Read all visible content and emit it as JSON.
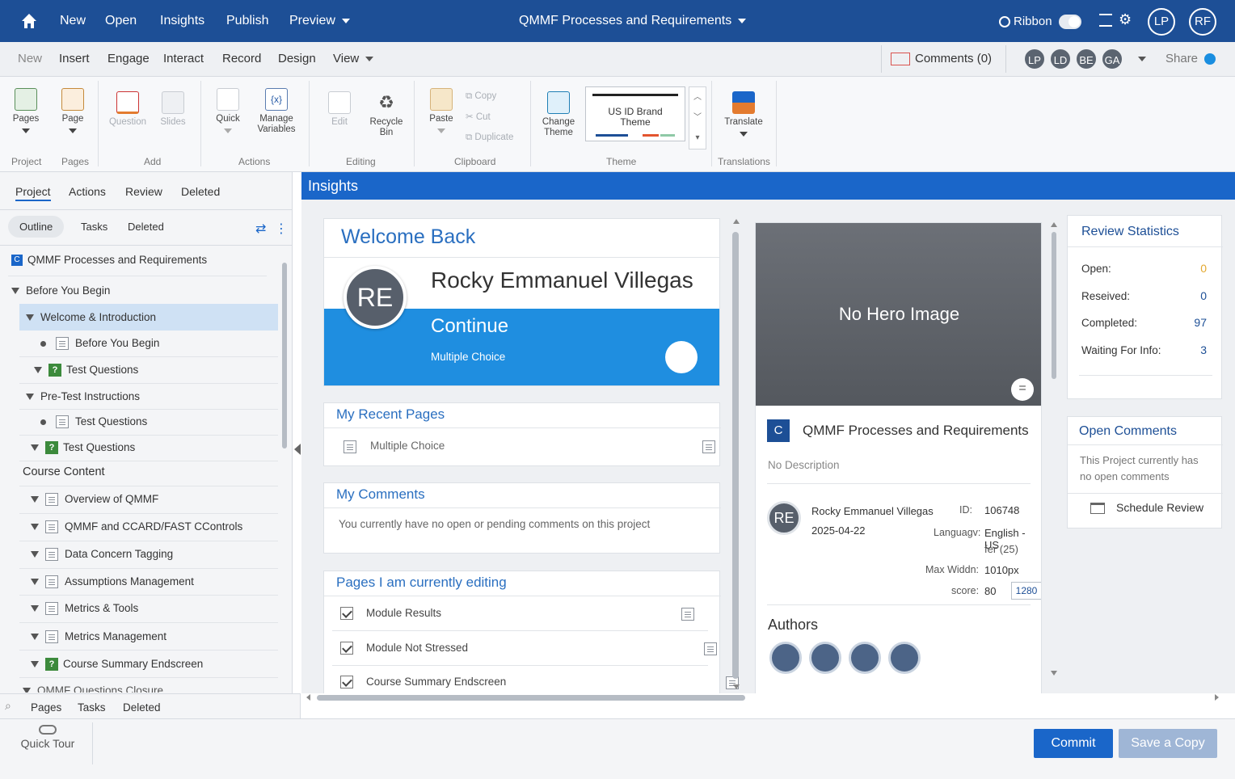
{
  "topbar": {
    "nav": [
      "New",
      "Open",
      "Insights",
      "Publish",
      "Preview"
    ],
    "project_title": "QMMF Processes and Requirements",
    "ribbon_label": "Ribbon",
    "user1": "LP",
    "user2": "RF"
  },
  "menubar": {
    "items": [
      "New",
      "Insert",
      "Engage",
      "Interact",
      "Record",
      "Design",
      "View"
    ],
    "comments_label": "Comments",
    "comments_count": "(0)",
    "avatars": [
      "LP",
      "LD",
      "BE",
      "GA"
    ],
    "share_label": "Share"
  },
  "ribbon": {
    "pages": "Pages",
    "page": "Page",
    "question": "Question",
    "slides": "Slides",
    "quick": "Quick",
    "manage_variables_1": "Manage",
    "manage_variables_2": "Variables",
    "edit": "Edit",
    "recycle_1": "Recycle",
    "recycle_2": "Bin",
    "paste": "Paste",
    "copy": "Copy",
    "cut": "Cut",
    "duplicate": "Duplicate",
    "change_theme_1": "Change",
    "change_theme_2": "Theme",
    "theme_preview_1": "US ID Brand",
    "theme_preview_2": "Theme",
    "translate": "Translate",
    "groups": {
      "project": "Project",
      "pages": "Pages",
      "add": "Add",
      "actions": "Actions",
      "editing": "Editing",
      "clipboard": "Clipboard",
      "theme": "Theme",
      "translations": "Translations"
    }
  },
  "left": {
    "tabs": [
      "Project",
      "Actions",
      "Review",
      "Deleted"
    ],
    "subtabs": [
      "Outline",
      "Tasks",
      "Deleted"
    ],
    "root": "QMMF Processes and Requirements",
    "root_badge": "C",
    "tree": {
      "before_you_begin": "Before You Begin",
      "welcome": "Welcome & Introduction",
      "before_you_begin_page": "Before You Begin",
      "test_questions_1": "Test Questions",
      "pretest": "Pre-Test Instructions",
      "test_questions_2": "Test Questions",
      "test_questions_3": "Test Questions",
      "course_content": "Course Content",
      "overview": "Overview of QMMF",
      "ccard": "QMMF and CCARD/FAST CControls",
      "data_concern": "Data Concern Tagging",
      "assumptions": "Assumptions Management",
      "metrics_tools": "Metrics & Tools",
      "metrics_mgmt": "Metrics Management",
      "course_summary": "Course Summary Endscreen",
      "cut_off": "QMMF Questions Closure"
    },
    "bottom_tabs": [
      "Pages",
      "Tasks",
      "Deleted"
    ],
    "quick_tour": "Quick Tour"
  },
  "insights": {
    "header": "Insights",
    "welcome_title": "Welcome Back",
    "avatar_initials": "RE",
    "user_name": "Rocky Emmanuel Villegas",
    "continue_label": "Continue",
    "continue_sub": "Multiple Choice",
    "recent_title": "My Recent Pages",
    "recent_item": "Multiple Choice",
    "comments_title": "My Comments",
    "comments_text": "You currently have no open or pending comments on this project",
    "editing_title": "Pages I am currently editing",
    "editing_items": [
      "Module Results",
      "Module Not Stressed",
      "Course Summary Endscreen"
    ],
    "hero_text": "No Hero Image",
    "project_badge": "C",
    "project_name": "QMMF Processes and Requirements",
    "project_desc": "No Description",
    "owner_initials": "RE",
    "owner_name": "Rocky Emmanuel Villegas",
    "owner_date": "2025-04-22",
    "id_label": "ID:",
    "id_value": "106748",
    "lang_label": "Languagv:",
    "lang_value1": "English - US",
    "lang_value2": "fer (25)",
    "maxw_label": "Max Widdn:",
    "maxw_value": "1010px",
    "score_label": "score:",
    "score_value": "80",
    "score_box": "1280",
    "authors_title": "Authors",
    "review_title": "Review Statistics",
    "stats": [
      {
        "label": "Open:",
        "value": "0"
      },
      {
        "label": "Reseived:",
        "value": "0"
      },
      {
        "label": "Completed:",
        "value": "97"
      },
      {
        "label": "Waiting For Info:",
        "value": "3"
      }
    ],
    "open_comments_title": "Open Comments",
    "open_comments_text1": "This Project currently has",
    "open_comments_text2": "no open comments",
    "schedule_review": "Schedule Review"
  },
  "footer": {
    "commit": "Commit",
    "save_copy": "Save a Copy"
  },
  "colors": {
    "brand": "#1d4f96",
    "accent": "#1a66c9",
    "continue_bg": "#1f8ee0"
  }
}
